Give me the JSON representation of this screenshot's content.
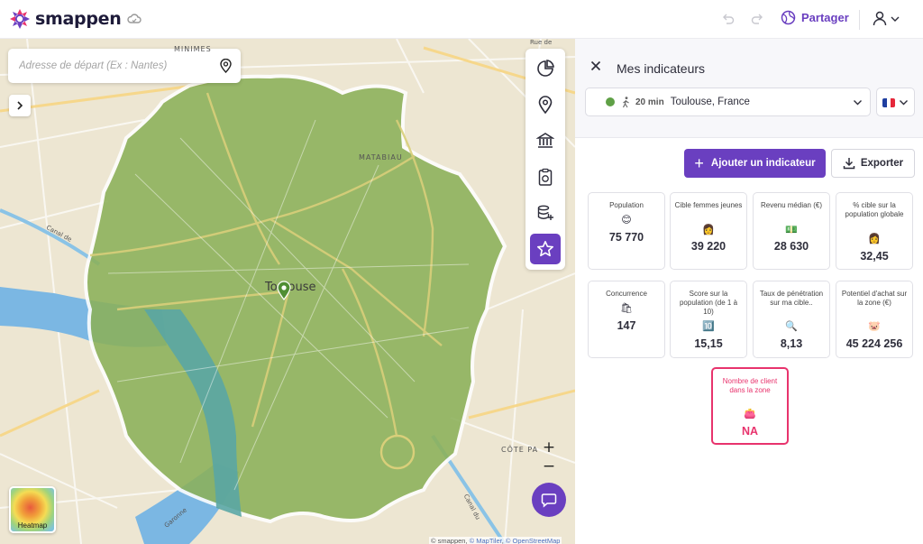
{
  "app": {
    "brand": "smappen"
  },
  "header": {
    "share_label": "Partager"
  },
  "map": {
    "search_placeholder": "Adresse de départ (Ex : Nantes)",
    "city_label": "Toulouse",
    "labels": {
      "district_1": "MATABIAU",
      "district_2": "CÔTE PA",
      "district_3": "MINIMES",
      "road_1": "Rue de",
      "river": "Garonne",
      "canal": "Canal de",
      "canal_2": "Canal du"
    },
    "zoom_in": "+",
    "zoom_out": "−",
    "heatmap_label": "Heatmap",
    "attribution": {
      "smappen": "© smappen",
      "maptiler": "© MapTiler",
      "osm": "© OpenStreetMap"
    },
    "zone_color": "#8cb15a"
  },
  "panel": {
    "title": "Mes indicateurs",
    "zone": {
      "minutes": "20 min",
      "city": "Toulouse, France",
      "color": "#5fa046"
    },
    "add_button": "Ajouter un indicateur",
    "export_button": "Exporter",
    "indicators": [
      {
        "label": "Population",
        "emoji": "😊",
        "value": "75 770"
      },
      {
        "label": "Cible femmes jeunes",
        "emoji": "👩",
        "value": "39 220"
      },
      {
        "label": "Revenu médian (€)",
        "emoji": "💵",
        "value": "28 630"
      },
      {
        "label": "% cible sur la population globale",
        "emoji": "👩",
        "value": "32,45"
      },
      {
        "label": "Concurrence",
        "emoji": "🛍",
        "value": "147"
      },
      {
        "label": "Score sur la population (de 1 à 10)",
        "emoji": "🔟",
        "value": "15,15"
      },
      {
        "label": "Taux de pénétration sur ma cible..",
        "emoji": "🔍",
        "value": "8,13"
      },
      {
        "label": "Potentiel d'achat sur la zone (€)",
        "emoji": "🐷",
        "value": "45 224 256"
      },
      {
        "label": "Nombre de client dans la zone",
        "emoji": "👛",
        "value": "NA"
      }
    ]
  },
  "colors": {
    "accent": "#6a3fc0",
    "alert": "#e8336d"
  }
}
